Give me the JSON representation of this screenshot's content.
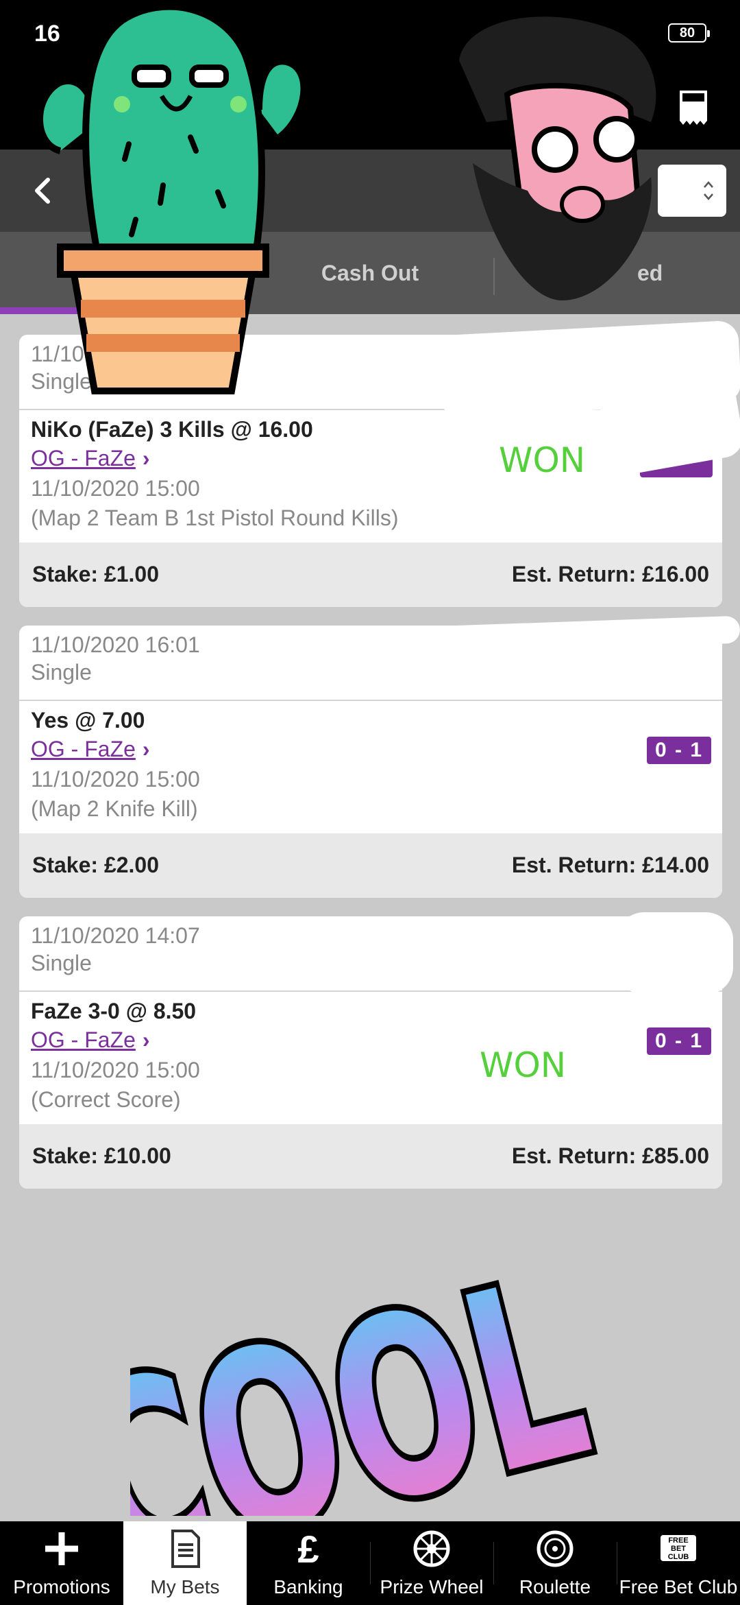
{
  "status_bar": {
    "time": "16",
    "battery": "80"
  },
  "tabs": [
    {
      "label": ""
    },
    {
      "label": "Cash Out"
    },
    {
      "label": "ed"
    }
  ],
  "bets": [
    {
      "date": "11/10",
      "type": "Single",
      "selection": "NiKo (FaZe) 3 Kills @ 16.00",
      "event": "OG - FaZe",
      "event_time": "11/10/2020 15:00",
      "market": "(Map 2 Team B 1st Pistol Round Kills)",
      "status": "WON",
      "stake": "Stake: £1.00",
      "est_return": "Est. Return: £16.00"
    },
    {
      "date": "11/10/2020 16:01",
      "type": "Single",
      "selection": "Yes @ 7.00",
      "event": "OG - FaZe",
      "event_time": "11/10/2020 15:00",
      "market": "(Map 2 Knife Kill)",
      "score": "0 - 1",
      "stake": "Stake: £2.00",
      "est_return": "Est. Return: £14.00"
    },
    {
      "date": "11/10/2020 14:07",
      "type": "Single",
      "selection": "FaZe 3-0 @ 8.50",
      "event": "OG - FaZe",
      "event_time": "11/10/2020 15:00",
      "market": "(Correct Score)",
      "score": "0 - 1",
      "status": "WON",
      "stake": "Stake: £10.00",
      "est_return": "Est. Return: £85.00"
    }
  ],
  "sticker_text": "COOL",
  "bottom_nav": [
    {
      "label": "Promotions",
      "icon": "plus-icon"
    },
    {
      "label": "My Bets",
      "icon": "document-icon"
    },
    {
      "label": "Banking",
      "icon": "pound-icon"
    },
    {
      "label": "Prize Wheel",
      "icon": "wheel-icon"
    },
    {
      "label": "Roulette",
      "icon": "roulette-icon"
    },
    {
      "label": "Free Bet Club",
      "icon": "free-bet-club-icon",
      "icon_text": "FREE BET CLUB"
    }
  ],
  "colors": {
    "accent": "#7a2f9c",
    "won": "#55d03c",
    "tab_indicator": "#8e3fb8"
  }
}
